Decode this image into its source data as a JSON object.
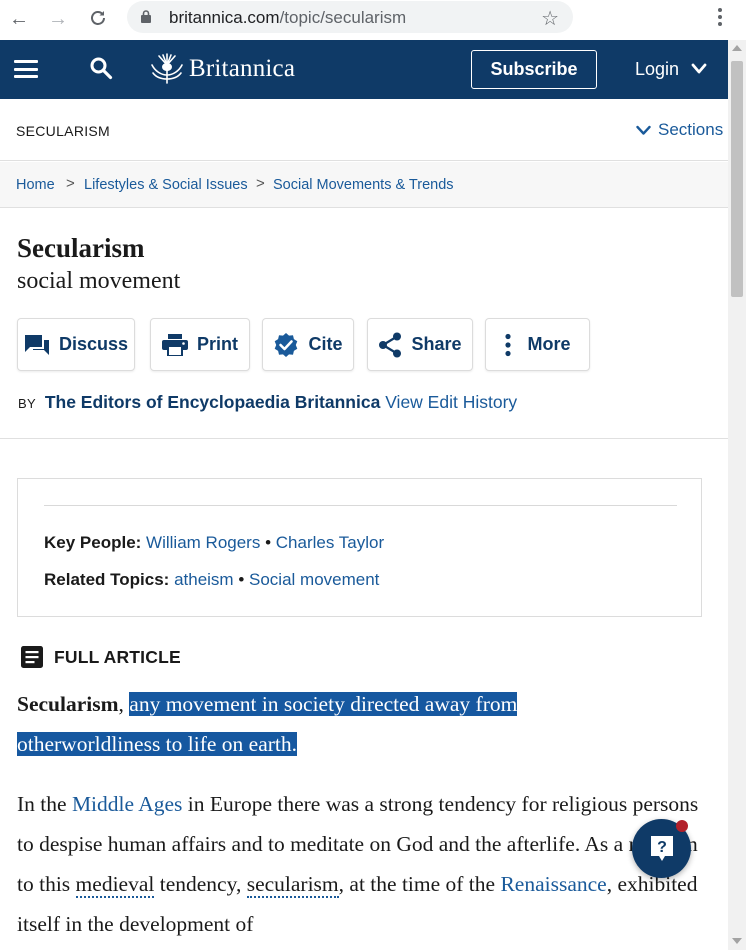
{
  "browser": {
    "url_host": "britannica.com",
    "url_path": "/topic/secularism"
  },
  "header": {
    "logo_text": "Britannica",
    "subscribe_label": "Subscribe",
    "login_label": "Login"
  },
  "topic_bar": {
    "topic": "SECULARISM",
    "sections_label": "Sections"
  },
  "breadcrumb": {
    "items": [
      "Home",
      "Lifestyles & Social Issues",
      "Social Movements & Trends"
    ],
    "separator": ">"
  },
  "article_header": {
    "title": "Secularism",
    "subtitle": "social movement"
  },
  "actions": {
    "discuss": "Discuss",
    "print": "Print",
    "cite": "Cite",
    "share": "Share",
    "more": "More"
  },
  "byline": {
    "by": "BY",
    "authors": "The Editors of Encyclopaedia Britannica",
    "history": "View Edit History"
  },
  "facts": {
    "key_people_label": "Key People:",
    "key_people": [
      "William Rogers",
      "Charles Taylor"
    ],
    "related_label": "Related Topics:",
    "related": [
      "atheism",
      "Social movement"
    ],
    "bullet": "•"
  },
  "full_article_label": "FULL ARTICLE",
  "article": {
    "lead_term": "Secularism",
    "lead_comma": ",",
    "lead_highlight_1": "any movement in society directed away from",
    "lead_highlight_2": "otherworldliness to life on earth.",
    "p2_a": "In the ",
    "p2_link1": "Middle Ages",
    "p2_b": " in Europe there was a strong tendency for religious persons to despise human affairs and to meditate on God and the afterlife. As a reaction to this ",
    "p2_dotted1": "medieval",
    "p2_c": " tendency, ",
    "p2_dotted2": "secularism",
    "p2_d": ", at the time of the ",
    "p2_link2": "Renaissance",
    "p2_e": ", exhibited itself in the development of"
  },
  "colors": {
    "header_bg": "#0f3a67",
    "link": "#1a5a9a",
    "highlight": "#1658a0"
  },
  "icons": [
    "back-arrow-icon",
    "forward-arrow-icon",
    "reload-icon",
    "lock-icon",
    "star-icon",
    "menu-icon",
    "search-icon",
    "thistle-logo-icon",
    "chevron-down-icon",
    "discuss-icon",
    "print-icon",
    "cite-icon",
    "share-icon",
    "more-icon",
    "article-icon",
    "help-icon"
  ]
}
